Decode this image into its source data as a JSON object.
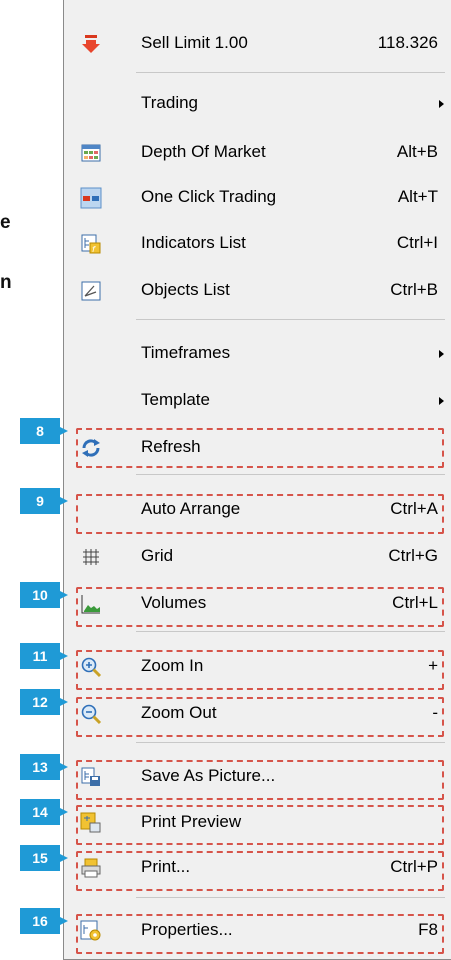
{
  "background": {
    "fragment1": "e",
    "fragment2": "n"
  },
  "menu": {
    "items": [
      {
        "label": "Sell Limit 1.00",
        "shortcut": "118.326",
        "icon": "sell-down-arrow-icon"
      },
      {
        "label": "Trading",
        "shortcut": "",
        "icon": ""
      },
      {
        "label": "Depth Of Market",
        "shortcut": "Alt+B",
        "icon": "depth-of-market-icon"
      },
      {
        "label": "One Click Trading",
        "shortcut": "Alt+T",
        "icon": "one-click-trading-icon"
      },
      {
        "label": "Indicators List",
        "shortcut": "Ctrl+I",
        "icon": "indicators-list-icon"
      },
      {
        "label": "Objects List",
        "shortcut": "Ctrl+B",
        "icon": "objects-list-icon"
      },
      {
        "label": "Timeframes",
        "shortcut": "",
        "icon": ""
      },
      {
        "label": "Template",
        "shortcut": "",
        "icon": ""
      },
      {
        "label": "Refresh",
        "shortcut": "",
        "icon": "refresh-icon"
      },
      {
        "label": "Auto Arrange",
        "shortcut": "Ctrl+A",
        "icon": ""
      },
      {
        "label": "Grid",
        "shortcut": "Ctrl+G",
        "icon": "grid-icon"
      },
      {
        "label": "Volumes",
        "shortcut": "Ctrl+L",
        "icon": "volumes-icon"
      },
      {
        "label": "Zoom In",
        "shortcut": "+",
        "icon": "zoom-in-icon"
      },
      {
        "label": "Zoom Out",
        "shortcut": "-",
        "icon": "zoom-out-icon"
      },
      {
        "label": "Save As Picture...",
        "shortcut": "",
        "icon": "save-as-picture-icon"
      },
      {
        "label": "Print Preview",
        "shortcut": "",
        "icon": "print-preview-icon"
      },
      {
        "label": "Print...",
        "shortcut": "Ctrl+P",
        "icon": "printer-icon"
      },
      {
        "label": "Properties...",
        "shortcut": "F8",
        "icon": "properties-icon"
      }
    ]
  },
  "badges": [
    "8",
    "9",
    "10",
    "11",
    "12",
    "13",
    "14",
    "15",
    "16"
  ],
  "colors": {
    "badge": "#1f9ad6",
    "callout_border": "#d6544a",
    "menu_bg": "#f0f0f0"
  }
}
